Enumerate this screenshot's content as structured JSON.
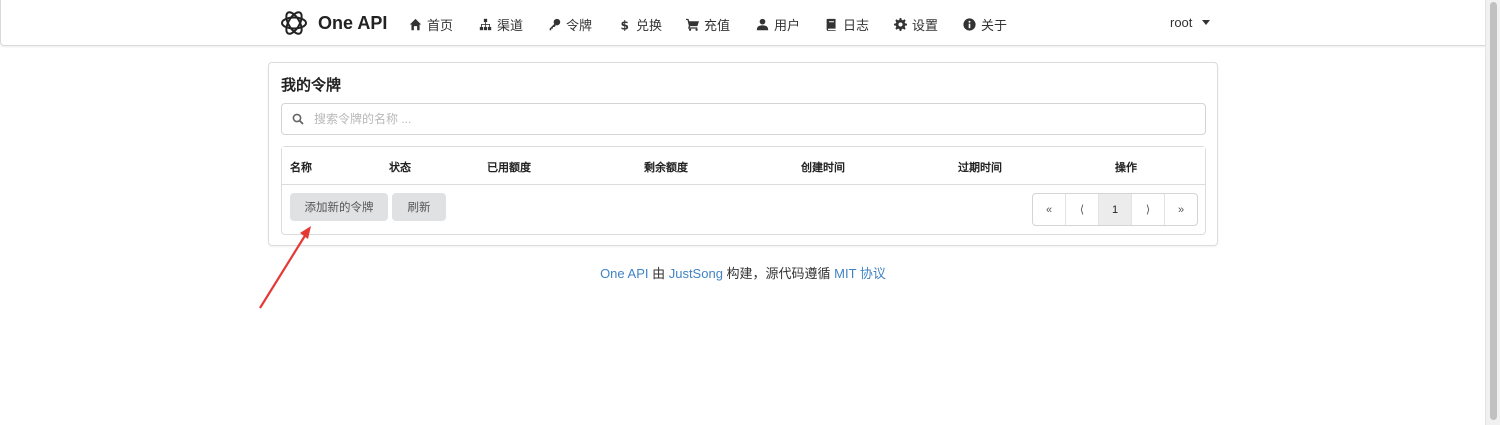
{
  "nav": {
    "brand": "One API",
    "items": [
      {
        "label": "首页",
        "icon": "home-icon"
      },
      {
        "label": "渠道",
        "icon": "sitemap-icon"
      },
      {
        "label": "令牌",
        "icon": "key-icon"
      },
      {
        "label": "兑换",
        "icon": "dollar-icon"
      },
      {
        "label": "充值",
        "icon": "cart-icon"
      },
      {
        "label": "用户",
        "icon": "user-icon"
      },
      {
        "label": "日志",
        "icon": "book-icon"
      },
      {
        "label": "设置",
        "icon": "gear-icon"
      },
      {
        "label": "关于",
        "icon": "info-icon"
      }
    ],
    "user": "root"
  },
  "main": {
    "title": "我的令牌",
    "search_placeholder": "搜索令牌的名称 ...",
    "columns": [
      "名称",
      "状态",
      "已用额度",
      "剩余额度",
      "创建时间",
      "过期时间",
      "操作"
    ],
    "add_button": "添加新的令牌",
    "refresh_button": "刷新",
    "pagination": [
      "«",
      "⟨",
      "1",
      "⟩",
      "»"
    ],
    "current_page": "1"
  },
  "footer": {
    "link1": "One API",
    "text1": " 由 ",
    "link2": "JustSong",
    "text2": " 构建，源代码遵循 ",
    "link3": "MIT 协议"
  },
  "colors": {
    "link": "#4183c4",
    "annotation_arrow": "#e53935",
    "button_bg": "#e0e1e2"
  }
}
